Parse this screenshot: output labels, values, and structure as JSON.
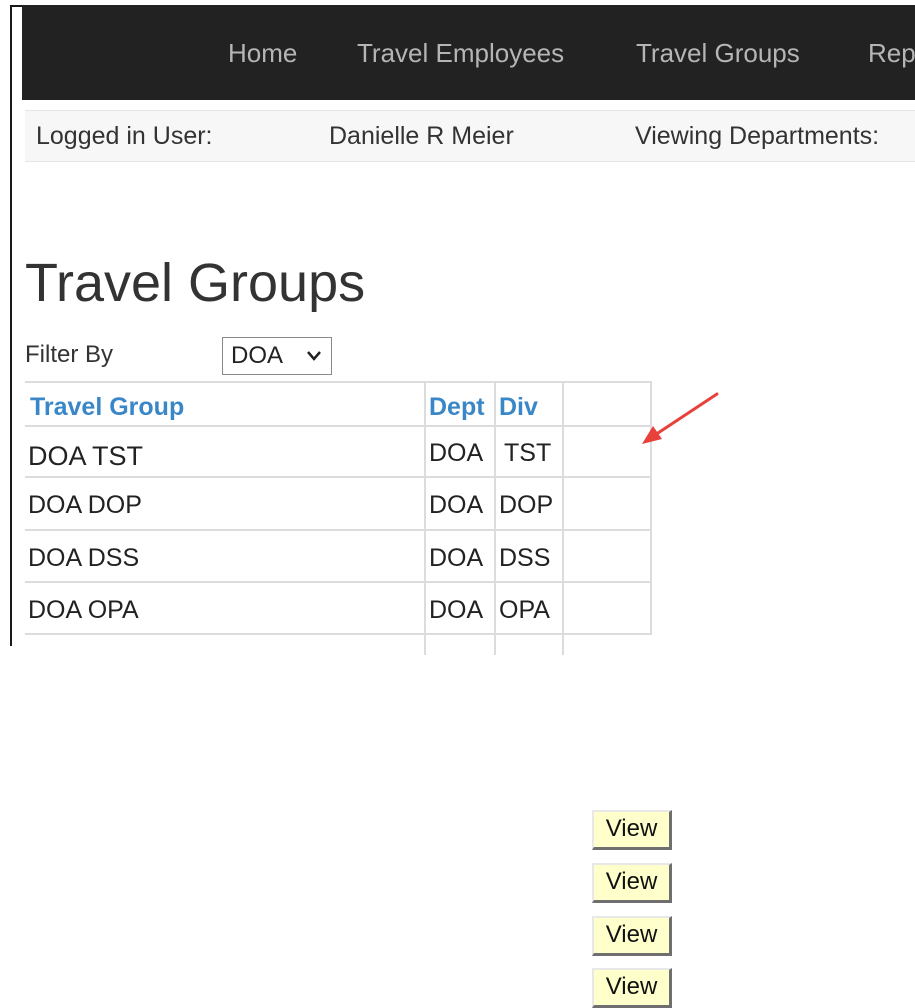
{
  "nav": {
    "items": [
      {
        "label": "Home"
      },
      {
        "label": "Travel Employees"
      },
      {
        "label": "Travel Groups"
      },
      {
        "label": "Rep"
      }
    ]
  },
  "userbar": {
    "logged_in_label": "Logged in User:",
    "user_name": "Danielle R Meier",
    "viewing_label": "Viewing Departments:"
  },
  "page": {
    "title": "Travel Groups"
  },
  "filter": {
    "label": "Filter By",
    "selected": "DOA"
  },
  "table": {
    "headers": {
      "group": "Travel Group",
      "dept": "Dept",
      "div": "Div"
    },
    "rows": [
      {
        "group": "DOA TST",
        "dept": "DOA",
        "div": "TST",
        "action": "View"
      },
      {
        "group": "DOA DOP",
        "dept": "DOA",
        "div": "DOP",
        "action": "View"
      },
      {
        "group": "DOA DSS",
        "dept": "DOA",
        "div": "DSS",
        "action": "View"
      },
      {
        "group": "DOA OPA",
        "dept": "DOA",
        "div": "OPA",
        "action": "View"
      }
    ]
  },
  "annotation": {
    "arrow_color": "#e8403a"
  }
}
